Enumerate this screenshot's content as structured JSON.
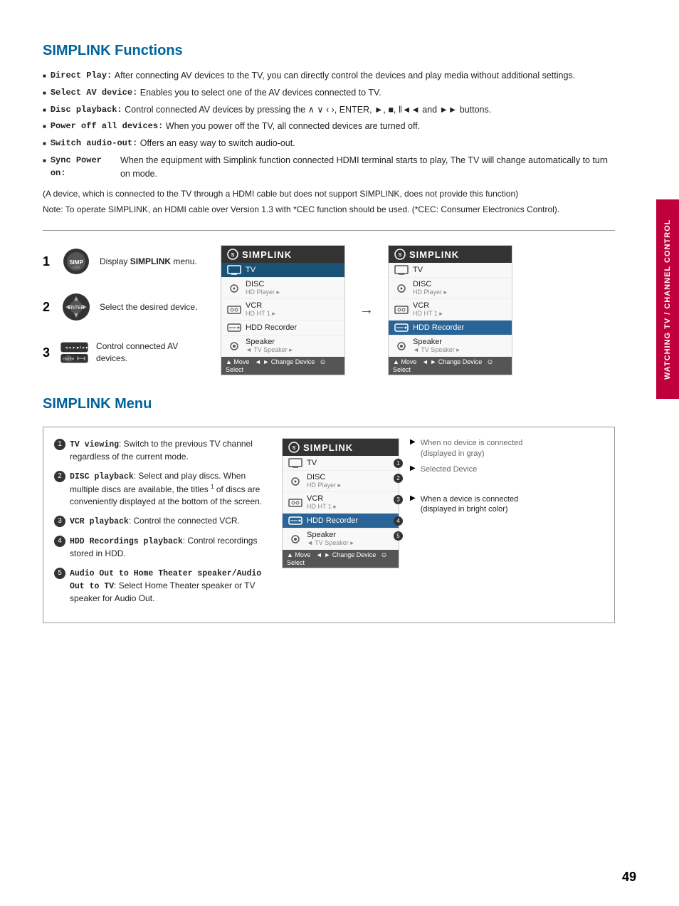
{
  "page": {
    "number": "49",
    "side_tab": "WATCHING TV / CHANNEL CONTROL"
  },
  "section1": {
    "title": "SIMPLINK Functions",
    "bullets": [
      {
        "label": "Direct Play:",
        "text": "After connecting AV devices to the TV, you can directly control the devices and play media without additional settings."
      },
      {
        "label": "Select AV device:",
        "text": "Enables you to select one of the AV devices connected to TV."
      },
      {
        "label": "Disc playback:",
        "text": "Control connected AV devices by pressing the  ∧  ∨  ‹  ›, ENTER, ►, ■, ‖◄◄ and ►► buttons."
      },
      {
        "label": "Power off all devices:",
        "text": "When you power off the TV, all connected devices are turned off."
      },
      {
        "label": "Switch audio-out:",
        "text": "Offers an easy way to switch audio-out."
      },
      {
        "label": "Sync Power on:",
        "text": "When the equipment with Simplink function connected HDMI terminal starts to play, The TV will change automatically to turn on mode."
      }
    ],
    "note1": "(A device, which is connected to the TV through a HDMI cable but does not support SIMPLINK, does not provide this function)",
    "note2": "Note: To operate SIMPLINK, an HDMI cable over Version 1.3 with *CEC function should be used. (*CEC: Consumer Electronics Control)."
  },
  "steps": [
    {
      "number": "1",
      "text": "Display SIMPLINK menu."
    },
    {
      "number": "2",
      "text": "Select the desired device."
    },
    {
      "number": "3",
      "text": "Control connected AV devices."
    }
  ],
  "simplink_menu_left": {
    "header": "SIMPLINK",
    "items": [
      {
        "icon": "tv",
        "name": "TV",
        "sub": "",
        "selected": true
      },
      {
        "icon": "disc",
        "name": "DISC",
        "sub": "HD Player ▸",
        "selected": false
      },
      {
        "icon": "vcr",
        "name": "VCR",
        "sub": "HD HT 1 ▸",
        "selected": false
      },
      {
        "icon": "hdd",
        "name": "HDD Recorder",
        "sub": "",
        "selected": false
      },
      {
        "icon": "speaker",
        "name": "Speaker",
        "sub": "◄ TV Speaker ▸",
        "selected": false
      }
    ],
    "footer": "▲ Move   ◄ ► Change Device   ⊙ Select"
  },
  "simplink_menu_right": {
    "header": "SIMPLINK",
    "items": [
      {
        "icon": "tv",
        "name": "TV",
        "sub": "",
        "selected": false
      },
      {
        "icon": "disc",
        "name": "DISC",
        "sub": "HD Player ▸",
        "selected": false
      },
      {
        "icon": "vcr",
        "name": "VCR",
        "sub": "HD HT 1 ▸",
        "selected": false
      },
      {
        "icon": "hdd",
        "name": "HDD Recorder",
        "sub": "",
        "selected": true
      },
      {
        "icon": "speaker",
        "name": "Speaker",
        "sub": "◄ TV Speaker ▸",
        "selected": false
      }
    ],
    "footer": "▲ Move   ◄ ► Change Device   ⊙ Select"
  },
  "section2": {
    "title": "SIMPLINK Menu",
    "menu_items": [
      {
        "number": "1",
        "label": "TV viewing",
        "text": ": Switch to the previous TV channel regardless of the current mode."
      },
      {
        "number": "2",
        "label": "DISC playback",
        "text": ": Select and play discs. When multiple discs are available, the titles of discs are conveniently displayed at the bottom of the screen."
      },
      {
        "number": "3",
        "label": "VCR playback",
        "text": ": Control the connected VCR."
      },
      {
        "number": "4",
        "label": "HDD Recordings playback",
        "text": ": Control recordings stored in HDD."
      },
      {
        "number": "5",
        "label": "Audio Out to Home Theater speaker/Audio Out to TV",
        "text": ": Select Home Theater speaker or TV speaker for Audio Out."
      }
    ],
    "simplink_center": {
      "header": "SIMPLINK",
      "items": [
        {
          "icon": "tv",
          "name": "TV",
          "sub": "",
          "selected": false
        },
        {
          "icon": "disc",
          "name": "DISC",
          "sub": "HD Player ▸",
          "selected": false
        },
        {
          "icon": "vcr",
          "name": "VCR",
          "sub": "HD HT 1 ▸",
          "selected": false
        },
        {
          "icon": "hdd",
          "name": "HDD Recorder",
          "sub": "",
          "selected": true
        },
        {
          "icon": "speaker",
          "name": "Speaker",
          "sub": "◄ TV Speaker ▸",
          "selected": false
        }
      ],
      "footer": "▲ Move   ◄ ► Change Device   ⊙ Select"
    },
    "legend": [
      {
        "type": "gray",
        "text": "When no device is connected (displayed in gray)"
      },
      {
        "type": "selected",
        "text": "Selected Device"
      },
      {
        "type": "bright",
        "text": "When a device is connected (displayed in bright color)"
      }
    ]
  }
}
